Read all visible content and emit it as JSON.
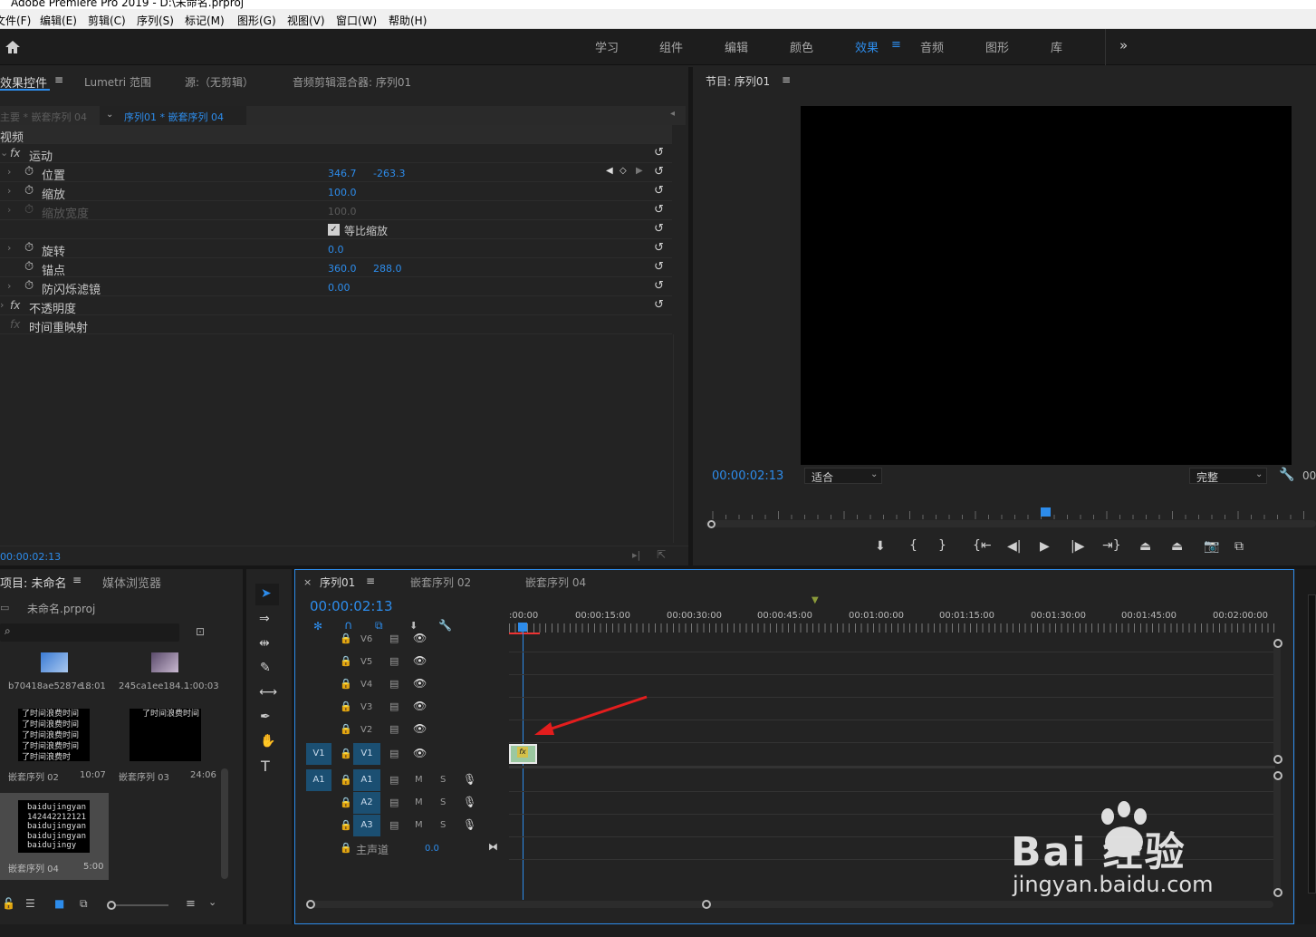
{
  "window": {
    "title": "Adobe Premiere Pro 2019 - D:\\未命名.prproj"
  },
  "menu": [
    "文件(F)",
    "编辑(E)",
    "剪辑(C)",
    "序列(S)",
    "标记(M)",
    "图形(G)",
    "视图(V)",
    "窗口(W)",
    "帮助(H)"
  ],
  "workspaces": [
    "学习",
    "组件",
    "编辑",
    "颜色",
    "效果",
    "音频",
    "图形",
    "库"
  ],
  "workspace_active": "效果",
  "effect_panel": {
    "tabs": [
      "效果控件",
      "Lumetri 范围",
      "源:（无剪辑）",
      "音频剪辑混合器: 序列01"
    ],
    "master": "主要 * 嵌套序列 04",
    "sequence": "序列01 * 嵌套序列 04",
    "section": "视频",
    "motion": "运动",
    "props": [
      {
        "name": "位置",
        "v1": "346.7",
        "v2": "-263.3"
      },
      {
        "name": "缩放",
        "v1": "100.0",
        "v2": ""
      },
      {
        "name": "缩放宽度",
        "v1": "100.0",
        "v2": ""
      },
      {
        "name": "等比缩放",
        "v1": "",
        "v2": ""
      },
      {
        "name": "旋转",
        "v1": "0.0",
        "v2": ""
      },
      {
        "name": "锚点",
        "v1": "360.0",
        "v2": "288.0"
      },
      {
        "name": "防闪烁滤镜",
        "v1": "0.00",
        "v2": ""
      }
    ],
    "opacity": "不透明度",
    "timeremap": "时间重映射",
    "timecode": "00:00:02:13"
  },
  "program": {
    "title": "节目: 序列01",
    "timecode": "00:00:02:13",
    "fit": "适合",
    "quality": "完整",
    "extra": "00"
  },
  "project": {
    "tabs": [
      "项目: 未命名",
      "媒体浏览器"
    ],
    "file": "未命名.prproj",
    "search_placeholder": "",
    "items": [
      {
        "name": "b70418ae5287e...",
        "dur": "18:01"
      },
      {
        "name": "245ca1ee184...",
        "dur": "1:00:03"
      },
      {
        "name": "嵌套序列 02",
        "dur": "10:07"
      },
      {
        "name": "嵌套序列 03",
        "dur": "24:06"
      },
      {
        "name": "嵌套序列 04",
        "dur": "5:00"
      }
    ],
    "thumb_text_a": "了时间浪费时间\n了时间浪费时间\n了时间浪费时间\n了时间浪费时间\n了时间浪费时",
    "thumb_text_b": "了时间浪费时间",
    "thumb_text_c": "baidujingyan\n142442212121\nbaidujingyan\nbaidujingyan\nbaidujingy"
  },
  "timeline": {
    "tabs": [
      "序列01",
      "嵌套序列 02",
      "嵌套序列 04"
    ],
    "timecode": "00:00:02:13",
    "ruler": [
      ":00:00",
      "00:00:15:00",
      "00:00:30:00",
      "00:00:45:00",
      "00:01:00:00",
      "00:01:15:00",
      "00:01:30:00",
      "00:01:45:00",
      "00:02:00:00"
    ],
    "video_tracks": [
      "V6",
      "V5",
      "V4",
      "V3",
      "V2",
      "V1"
    ],
    "audio_tracks": [
      "A1",
      "A2",
      "A3"
    ],
    "src_v": "V1",
    "src_a": "A1",
    "master": "主声道",
    "master_val": "0.0",
    "m": "M",
    "s": "S",
    "clip_label": "fx"
  },
  "watermark": {
    "brand": "Bai 经验",
    "url": "jingyan.baidu.com"
  }
}
